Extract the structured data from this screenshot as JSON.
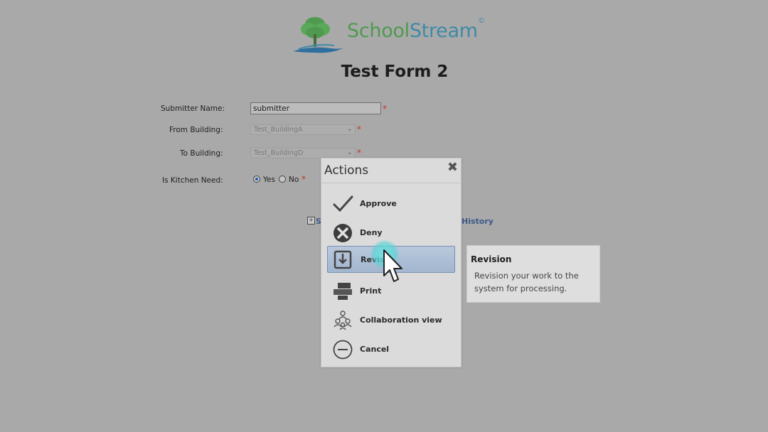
{
  "brand": {
    "part1": "School",
    "part2": "Stream",
    "mark": "©"
  },
  "page_title": "Test Form 2",
  "form": {
    "submitter": {
      "label": "Submitter Name:",
      "value": "submitter",
      "required": "*"
    },
    "from_building": {
      "label": "From Building:",
      "value": "Test_BuildingA",
      "required": "*"
    },
    "to_building": {
      "label": "To Building:",
      "value": "Test_BuildingD",
      "required": "*"
    },
    "kitchen_need": {
      "label": "Is Kitchen Need:",
      "options": [
        "Yes",
        "No"
      ],
      "selected": "Yes",
      "required": "*"
    }
  },
  "links": {
    "left_partial": "S",
    "history": "History"
  },
  "modal": {
    "title": "Actions",
    "close": "✖",
    "actions": [
      {
        "label": "Approve",
        "icon": "check-icon"
      },
      {
        "label": "Deny",
        "icon": "deny-x-circle-icon"
      },
      {
        "label": "Revisio",
        "icon": "revision-icon"
      },
      {
        "label": "Print",
        "icon": "print-icon"
      },
      {
        "label": "Collaboration view",
        "icon": "collaboration-icon"
      },
      {
        "label": "Cancel",
        "icon": "cancel-circle-icon"
      }
    ],
    "selected_action": "Revision"
  },
  "tooltip": {
    "title": "Revision",
    "body": "Revision your work to the system for processing."
  },
  "colors": {
    "overlay_bg": "#a9a9a9",
    "brand_green": "#4f9a50",
    "brand_blue": "#3f8aa6",
    "required": "#c0392b",
    "selected_action_bg": "#a2b6cf",
    "click_highlight": "#6ee6e1"
  }
}
